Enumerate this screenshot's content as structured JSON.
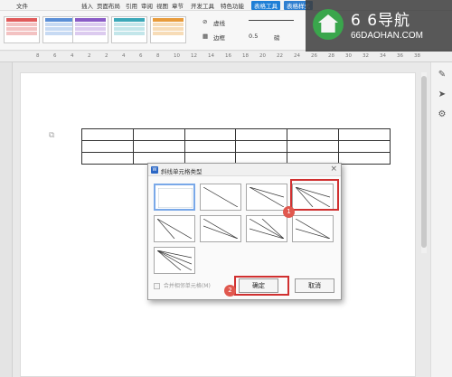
{
  "menubar": {
    "items": [
      {
        "label": "文件"
      },
      {
        "label": "插入"
      },
      {
        "label": "页面布局"
      },
      {
        "label": "引用"
      },
      {
        "label": "审阅"
      },
      {
        "label": "视图"
      },
      {
        "label": "章节"
      },
      {
        "label": "开发工具"
      },
      {
        "label": "特色功能"
      },
      {
        "label": "表格工具"
      },
      {
        "label": "表格样式"
      }
    ]
  },
  "ribbon": {
    "line_style_label": "虚线",
    "border_label": "边框",
    "line_width_value": "0.5",
    "line_width_unit": "磅"
  },
  "ruler": {
    "numbers": [
      "8",
      "6",
      "4",
      "2",
      "2",
      "4",
      "6",
      "8",
      "10",
      "12",
      "14",
      "16",
      "18",
      "20",
      "22",
      "24",
      "26",
      "28",
      "30",
      "32",
      "34",
      "36",
      "38"
    ]
  },
  "logo": {
    "title": "6 6导航",
    "url": "66DAOHAN.COM"
  },
  "dialog": {
    "title": "斜线单元格类型",
    "merge_checkbox_label": "合并相邻单元格(M)",
    "ok_label": "确定",
    "cancel_label": "取消",
    "options": [
      {
        "name": "none"
      },
      {
        "name": "single-diagonal"
      },
      {
        "name": "two-lines-top-left"
      },
      {
        "name": "two-lines-top-right"
      },
      {
        "name": "diagonal-from-corner"
      },
      {
        "name": "single-diagonal-reverse"
      },
      {
        "name": "two-lines-bottom-right"
      },
      {
        "name": "two-lines-bottom-left"
      },
      {
        "name": "three-lines-fan"
      }
    ]
  },
  "annotations": {
    "step1": "1",
    "step2": "2",
    "color": "#d03030"
  },
  "colors": {
    "accent": "#1e7fd6",
    "logo_green": "#3aa64c",
    "highlight_red": "#d03030"
  }
}
